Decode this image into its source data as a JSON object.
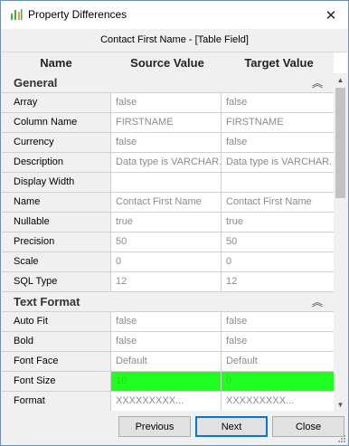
{
  "window": {
    "title": "Property Differences",
    "close_glyph": "✕"
  },
  "subtitle": "Contact First Name - [Table Field]",
  "columns": {
    "name": "Name",
    "source": "Source Value",
    "target": "Target Value"
  },
  "groups": [
    {
      "label": "General",
      "rows": [
        {
          "name": "Array",
          "source": "false",
          "target": "false"
        },
        {
          "name": "Column Name",
          "source": "FIRSTNAME",
          "target": "FIRSTNAME"
        },
        {
          "name": "Currency",
          "source": "false",
          "target": "false"
        },
        {
          "name": "Description",
          "source": "Data type is VARCHAR.",
          "target": "Data type is VARCHAR."
        },
        {
          "name": "Display Width",
          "source": "",
          "target": ""
        },
        {
          "name": "Name",
          "source": "Contact First Name",
          "target": "Contact First Name"
        },
        {
          "name": "Nullable",
          "source": "true",
          "target": "true"
        },
        {
          "name": "Precision",
          "source": "50",
          "target": "50"
        },
        {
          "name": "Scale",
          "source": "0",
          "target": "0"
        },
        {
          "name": "SQL Type",
          "source": "12",
          "target": "12"
        }
      ]
    },
    {
      "label": "Text Format",
      "rows": [
        {
          "name": "Auto Fit",
          "source": "false",
          "target": "false"
        },
        {
          "name": "Bold",
          "source": "false",
          "target": "false"
        },
        {
          "name": "Font Face",
          "source": "Default",
          "target": "Default"
        },
        {
          "name": "Font Size",
          "source": "10",
          "target": "0",
          "different": true
        },
        {
          "name": "Format",
          "source": "XXXXXXXXX...",
          "target": "XXXXXXXXX..."
        }
      ]
    }
  ],
  "buttons": {
    "previous": "Previous",
    "next": "Next",
    "close": "Close"
  },
  "colors": {
    "diff_highlight": "#21ff21",
    "accent": "#0078d7"
  },
  "icons": {
    "collapse": "double-chevron-up-icon",
    "app": "property-diff-icon"
  }
}
